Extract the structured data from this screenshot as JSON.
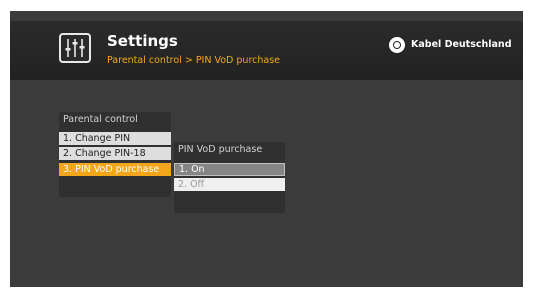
{
  "header": {
    "title": "Settings",
    "breadcrumb": "Parental control > PIN VoD purchase",
    "brand": "Kabel Deutschland",
    "settings_icon": "equalizer-sliders-icon",
    "brand_icon": "kabel-deutschland-logo-icon"
  },
  "parental_menu": {
    "title": "Parental control",
    "items": [
      {
        "label": "1. Change PIN",
        "state": "normal"
      },
      {
        "label": "2. Change PIN-18",
        "state": "normal"
      },
      {
        "label": "3. PIN VoD purchase",
        "state": "selected"
      }
    ]
  },
  "vod_menu": {
    "title": "PIN VoD purchase",
    "items": [
      {
        "label": "1. On",
        "state": "focused"
      },
      {
        "label": "2. Off",
        "state": "normal"
      }
    ]
  },
  "colors": {
    "accent": "#f3a51c",
    "background": "#3b3b3b",
    "header": "#262626"
  }
}
